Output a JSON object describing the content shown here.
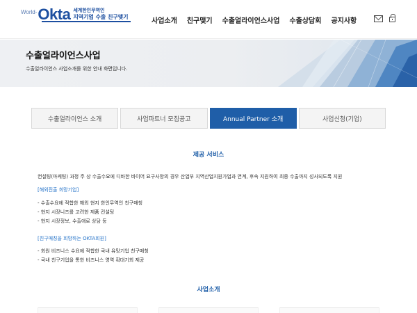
{
  "header": {
    "logo": {
      "world": "World-",
      "okta": "Okta",
      "line1": "세계한인무역인",
      "line2": "지역기업 수출 친구맺기"
    },
    "nav": [
      "사업소개",
      "친구맺기",
      "수출얼라이언스사업",
      "수출상담회",
      "공지사항"
    ],
    "icons": [
      "mail-icon",
      "lock-icon"
    ]
  },
  "hero": {
    "title": "수출얼라이언스사업",
    "description": "수출얼라이언스 사업소개를 위한 안내 화면입니다."
  },
  "tabs": [
    {
      "label": "수출얼라이언스 소개",
      "active": false
    },
    {
      "label": "사업파트너 모집공고",
      "active": false
    },
    {
      "label": "Annual Partner 소개",
      "active": true
    },
    {
      "label": "사업신청(기업)",
      "active": false
    }
  ],
  "service": {
    "title": "제공 서비스",
    "intro": "컨설팅(마케팅) 과정 주 상 수출수요에 디바한 바이어 요구사항의 경우 산업부 지역산업지원가업과 연계, 후속 지원하여 최종 수출까지 성사되도록 지원",
    "group1": {
      "heading": "[해외진출 희망기업]",
      "items": [
        "- 수출수요에 적합한 해외 현지 한인무역인 친구매칭",
        "- 현지 시장니즈를 고려한 제품 컨설팅",
        "- 현지 시장정보, 수출애로 상담 등"
      ]
    },
    "group2": {
      "heading": "[친구매칭을 희망하는 OKTA회원]",
      "items": [
        "- 회원 비즈니스 수요에 적합한 국내 유망기업 친구매칭",
        "- 국내 친구기업을 통한 비즈니스 영역 확대기회 제공"
      ]
    }
  },
  "business": {
    "title": "사업소개"
  },
  "colors": {
    "accent": "#1f5ea8",
    "link": "#1f6fc7",
    "tab_inactive": "#f4f4f4"
  }
}
